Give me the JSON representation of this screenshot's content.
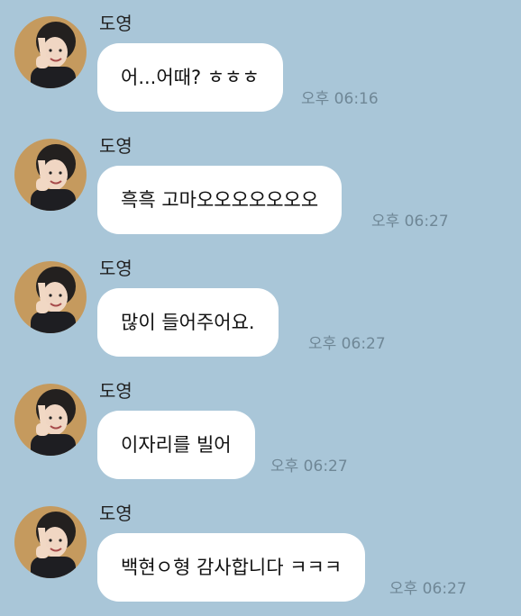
{
  "messages": [
    {
      "sender": "도영",
      "text": "어...어때? ㅎㅎㅎ",
      "time": "오후 06:16"
    },
    {
      "sender": "도영",
      "text": "흑흑 고마오오오오오오오",
      "time": "오후 06:27"
    },
    {
      "sender": "도영",
      "text": "많이 들어주어요.",
      "time": "오후 06:27"
    },
    {
      "sender": "도영",
      "text": "이자리를 빌어",
      "time": "오후 06:27"
    },
    {
      "sender": "도영",
      "text": "백현ㅇ형 감사합니다 ㅋㅋㅋ",
      "time": "오후 06:27"
    }
  ],
  "colors": {
    "background": "#a9c6d8",
    "bubble": "#ffffff",
    "time_text": "#6f8796"
  },
  "icons": {
    "avatar": "profile-photo-icon"
  }
}
